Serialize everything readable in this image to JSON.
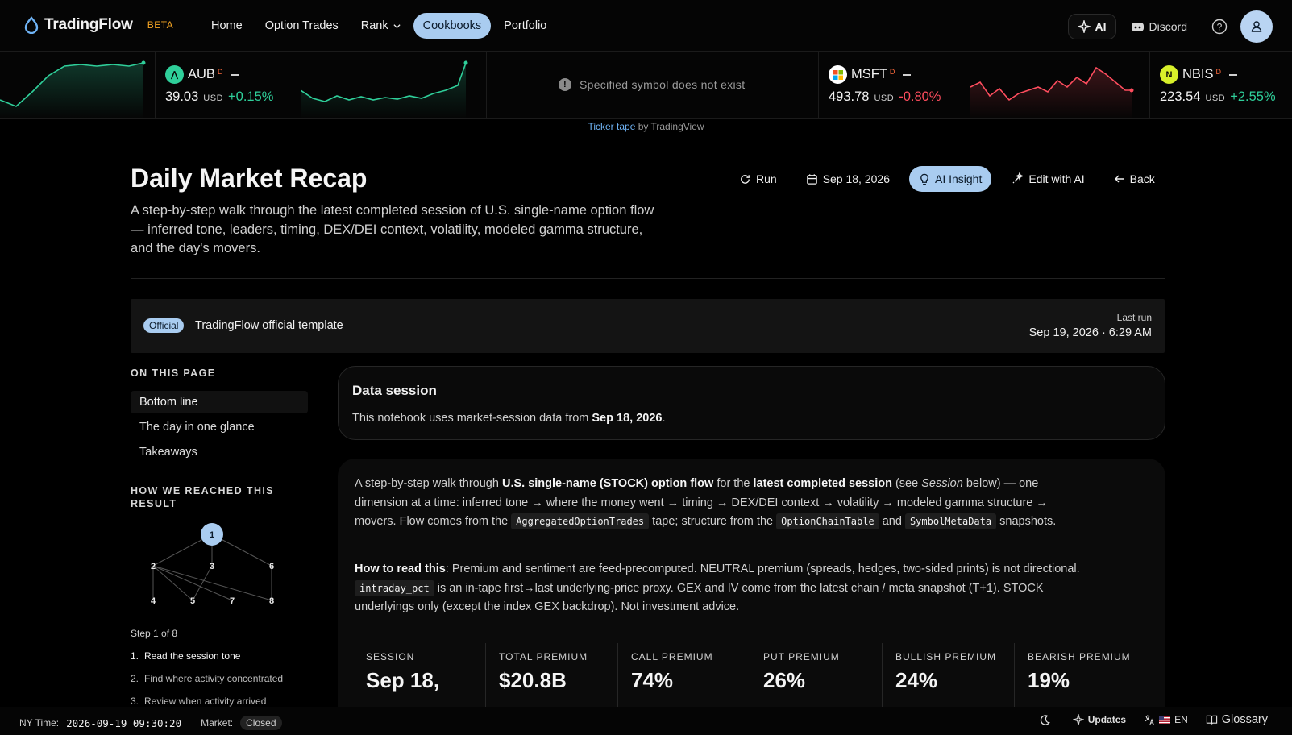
{
  "brand": {
    "name": "TradingFlow",
    "badge": "BETA"
  },
  "nav": {
    "home": "Home",
    "option_trades": "Option Trades",
    "rank": "Rank",
    "cookbooks": "Cookbooks",
    "portfolio": "Portfolio",
    "ai": "AI",
    "discord": "Discord"
  },
  "ticker": {
    "items": [
      {
        "symbol": "AUB",
        "flag": "D",
        "price": "39.03",
        "currency": "USD",
        "change": "+0.15%",
        "direction": "up"
      },
      {
        "symbol": "MSFT",
        "flag": "D",
        "price": "493.78",
        "currency": "USD",
        "change": "-0.80%",
        "direction": "down"
      },
      {
        "symbol": "NBIS",
        "flag": "D",
        "price": "223.54",
        "currency": "USD",
        "change": "+2.55%",
        "direction": "up"
      }
    ],
    "error": "Specified symbol does not exist",
    "credit_link": "Ticker tape",
    "credit_rest": " by TradingView"
  },
  "page": {
    "title": "Daily Market Recap",
    "subtitle": "A step-by-step walk through the latest completed session of U.S. single-name option flow — inferred tone, leaders, timing, DEX/DEI context, volatility, modeled gamma structure, and the day's movers.",
    "actions": {
      "run": "Run",
      "date": "Sep 18, 2026",
      "ai_insight": "AI Insight",
      "edit": "Edit with AI",
      "back": "Back"
    }
  },
  "template": {
    "tag": "Official",
    "name": "TradingFlow official template",
    "last_run_label": "Last run",
    "last_run_value": "Sep 19, 2026 · 6:29 AM"
  },
  "sidebar": {
    "on_this_page": "ON THIS PAGE",
    "links": [
      "Bottom line",
      "The day in one glance",
      "Takeaways"
    ],
    "how_heading": "HOW WE REACHED THIS RESULT",
    "graph_nodes": [
      "1",
      "2",
      "3",
      "6",
      "4",
      "5",
      "7",
      "8"
    ],
    "step_count": "Step 1 of 8",
    "steps": [
      {
        "n": "1.",
        "label": "Read the session tone"
      },
      {
        "n": "2.",
        "label": "Find where activity concentrated"
      },
      {
        "n": "3.",
        "label": "Review when activity arrived"
      }
    ]
  },
  "data_session": {
    "heading": "Data session",
    "text_pre": "This notebook uses market-session data from ",
    "date": "Sep 18, 2026",
    "text_post": "."
  },
  "intro": {
    "p1_a": "A step-by-step walk through ",
    "p1_b": "U.S. single-name (STOCK) option flow",
    "p1_c": " for the ",
    "p1_d": "latest completed session",
    "p1_e": " (see ",
    "p1_f": "Session",
    "p1_g": " below) — one dimension at a time: inferred tone → where the money went → timing → DEX/DEI context → volatility → modeled gamma structure → movers. Flow comes from the ",
    "code1": "AggregatedOptionTrades",
    "p1_h": " tape; structure from the ",
    "code2": "OptionChainTable",
    "p1_i": " and ",
    "code3": "SymbolMetaData",
    "p1_j": " snapshots.",
    "p2_label": "How to read this",
    "p2_a": ": Premium and sentiment are feed-precomputed. NEUTRAL premium (spreads, hedges, two-sided prints) is not directional.",
    "code4": "intraday_pct",
    "p2_b": " is an in-tape first→last underlying-price proxy. GEX and IV come from the latest chain / meta snapshot (T+1). STOCK underlyings only (except the index GEX backdrop). Not investment advice."
  },
  "stats": [
    {
      "label": "SESSION",
      "value": "Sep 18,"
    },
    {
      "label": "TOTAL PREMIUM",
      "value": "$20.8B"
    },
    {
      "label": "CALL PREMIUM",
      "value": "74%"
    },
    {
      "label": "PUT PREMIUM",
      "value": "26%"
    },
    {
      "label": "BULLISH PREMIUM",
      "value": "24%"
    },
    {
      "label": "BEARISH PREMIUM",
      "value": "19%"
    }
  ],
  "status": {
    "ny_label": "NY Time:",
    "ny_time": "2026-09-19 09:30:20",
    "market_label": "Market:",
    "market_state": "Closed",
    "updates": "Updates",
    "lang": "EN",
    "glossary": "Glossary"
  },
  "colors": {
    "accent": "#a9ccf0",
    "up": "#2fcf9a",
    "down": "#ff4d5e",
    "beta": "#f5a524"
  }
}
